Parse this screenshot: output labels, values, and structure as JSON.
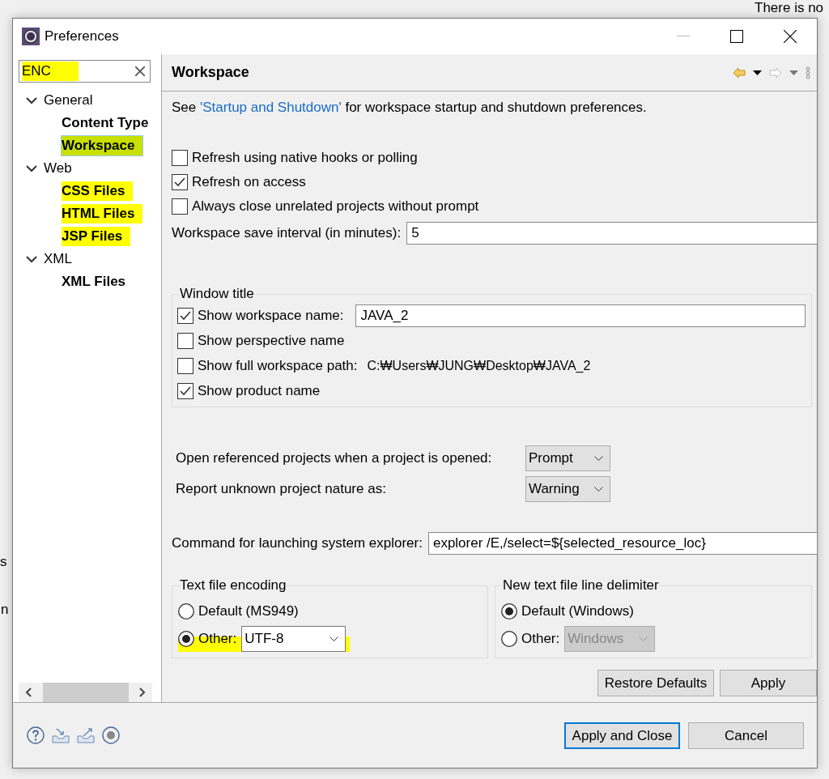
{
  "background_window": {
    "top_right_text": "There is no",
    "left_texts": [
      "s",
      "n"
    ]
  },
  "window": {
    "title": "Preferences"
  },
  "filter": {
    "value": "ENC",
    "highlighted": true
  },
  "tree": [
    {
      "label": "General",
      "expanded": true,
      "matched": false,
      "selected": false,
      "highlighted": false,
      "children": [
        {
          "label": "Content Type",
          "matched": true,
          "selected": false,
          "highlighted": false
        },
        {
          "label": "Workspace",
          "matched": true,
          "selected": true,
          "highlighted": true
        }
      ]
    },
    {
      "label": "Web",
      "expanded": true,
      "matched": false,
      "selected": false,
      "highlighted": false,
      "children": [
        {
          "label": "CSS Files",
          "matched": true,
          "selected": false,
          "highlighted": true
        },
        {
          "label": "HTML Files",
          "matched": true,
          "selected": false,
          "highlighted": true
        },
        {
          "label": "JSP Files",
          "matched": true,
          "selected": false,
          "highlighted": true
        }
      ]
    },
    {
      "label": "XML",
      "expanded": true,
      "matched": false,
      "selected": false,
      "highlighted": false,
      "children": [
        {
          "label": "XML Files",
          "matched": true,
          "selected": false,
          "highlighted": false
        }
      ]
    }
  ],
  "page": {
    "title": "Workspace",
    "back_enabled": true,
    "forward_enabled": false,
    "intro_before": "See ",
    "intro_link": "'Startup and Shutdown'",
    "intro_after": " for workspace startup and shutdown preferences."
  },
  "options": [
    {
      "kind": "checkbox",
      "label": "Refresh using native hooks or polling",
      "checked": false
    },
    {
      "kind": "checkbox",
      "label": "Refresh on access",
      "checked": true
    },
    {
      "kind": "checkbox",
      "label": "Always close unrelated projects without prompt",
      "checked": false
    },
    {
      "kind": "field",
      "label": "Workspace save interval (in minutes):",
      "value": "5"
    }
  ],
  "window_title_group": {
    "title": "Window title",
    "items": [
      {
        "kind": "checkbox_field",
        "label": "Show workspace name:",
        "checked": true,
        "value": "JAVA_2"
      },
      {
        "kind": "checkbox",
        "label": "Show perspective name",
        "checked": false
      },
      {
        "kind": "checkbox_text",
        "label": "Show full workspace path:",
        "checked": false,
        "value": "C:₩Users₩JUNG₩Desktop₩JAVA_2"
      },
      {
        "kind": "checkbox",
        "label": "Show product name",
        "checked": true
      }
    ]
  },
  "dropdowns": [
    {
      "label": "Open referenced projects when a project is opened:",
      "value": "Prompt"
    },
    {
      "label": "Report unknown project nature as:",
      "value": "Warning"
    }
  ],
  "explorer_command": {
    "label": "Command for launching system explorer:",
    "value": "explorer /E,/select=${selected_resource_loc}"
  },
  "encoding": {
    "title": "Text file encoding",
    "options": [
      {
        "label": "Default (MS949)",
        "selected": false
      },
      {
        "label": "Other:",
        "selected": true,
        "value": "UTF-8",
        "disabled": false,
        "highlighted": true
      }
    ]
  },
  "line_delimiter": {
    "title": "New text file line delimiter",
    "options": [
      {
        "label": "Default (Windows)",
        "selected": true
      },
      {
        "label": "Other:",
        "selected": false,
        "value": "Windows",
        "disabled": true
      }
    ]
  },
  "page_buttons": [
    "Restore Defaults",
    "Apply"
  ],
  "footer_buttons": [
    {
      "label": "Apply and Close",
      "focused": true
    },
    {
      "label": "Cancel",
      "focused": false
    }
  ]
}
